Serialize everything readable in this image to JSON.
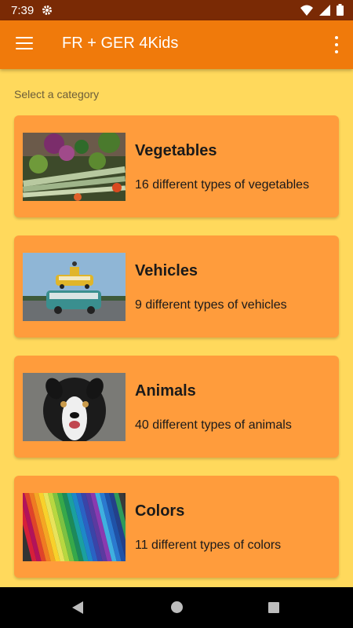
{
  "status_bar": {
    "time": "7:39",
    "icons": [
      "gear-icon",
      "wifi-icon",
      "signal-icon",
      "battery-icon"
    ]
  },
  "app_bar": {
    "title": "FR + GER 4Kids",
    "menu_icon": "hamburger-menu-icon",
    "overflow_icon": "more-vert-icon"
  },
  "prompt": "Select a category",
  "categories": [
    {
      "name": "Vegetables",
      "description": "16 different types of vegetables",
      "image": "vegetables-photo"
    },
    {
      "name": "Vehicles",
      "description": "9 different types of vehicles",
      "image": "vehicles-photo"
    },
    {
      "name": "Animals",
      "description": "40 different types of animals",
      "image": "dog-photo"
    },
    {
      "name": "Colors",
      "description": "11 different types of colors",
      "image": "colored-pencils-photo"
    }
  ],
  "nav_bar": {
    "buttons": [
      "back-icon",
      "home-icon",
      "recents-icon"
    ]
  },
  "colors": {
    "status_bar": "#7A2A05",
    "app_bar": "#F07A0B",
    "background": "#FFD95C",
    "card": "#FF9C3C"
  }
}
